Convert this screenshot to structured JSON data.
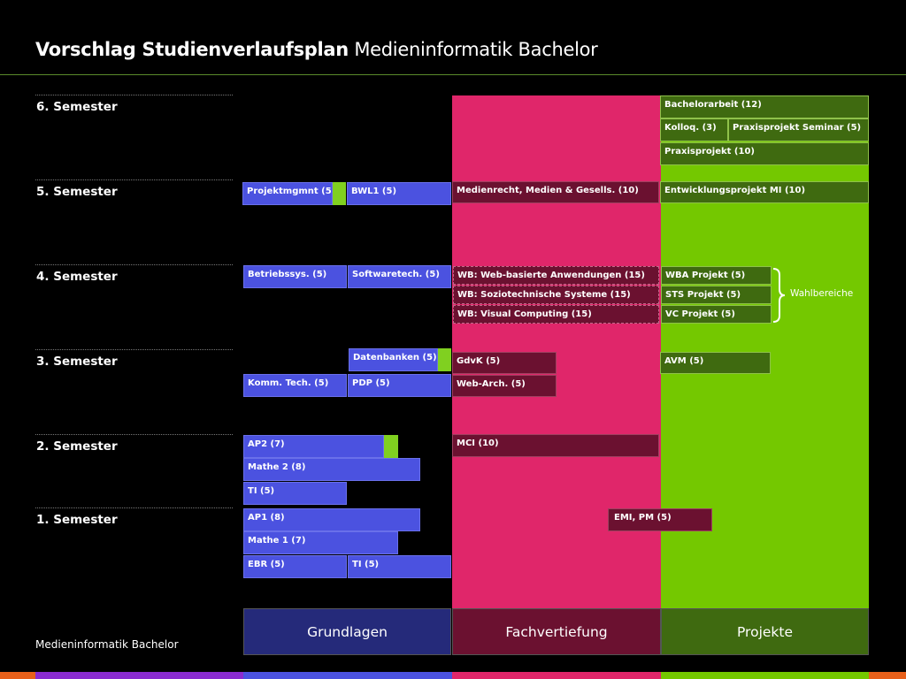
{
  "title": {
    "bold": "Vorschlag Studienverlaufsplan",
    "light": "Medieninformatik Bachelor"
  },
  "semesters": [
    "6. Semester",
    "5. Semester",
    "4. Semester",
    "3. Semester",
    "2. Semester",
    "1. Semester"
  ],
  "columns": {
    "grundlagen": "Grundlagen",
    "fachvertiefung": "Fachvertiefung",
    "projekte": "Projekte"
  },
  "colors": {
    "grundlagen_blue": "#4b52e0",
    "fachvertiefung_pink": "#e0266a",
    "fachvertiefung_maroon": "#6b1130",
    "projekte_green": "#74c800",
    "projekte_dark_green": "#3f6a10",
    "accent_green": "#80d020"
  },
  "modules": {
    "bachelorarbeit": "Bachelorarbeit (12)",
    "kolloq": "Kolloq. (3)",
    "praxisprojekt_seminar": "Praxisprojekt Seminar (5)",
    "praxisprojekt": "Praxisprojekt (10)",
    "projektmgmnt": "Projektmgmnt (5)",
    "bwl1": "BWL1 (5)",
    "medienrecht": "Medienrecht, Medien & Gesells. (10)",
    "entwicklungsprojekt": "Entwicklungsprojekt MI (10)",
    "betriebssys": "Betriebssys. (5)",
    "softwaretech": "Softwaretech. (5)",
    "wb_web": "WB: Web-basierte Anwendungen (15)",
    "wb_sozio": "WB: Soziotechnische Systeme (15)",
    "wb_visual": "WB: Visual Computing (15)",
    "wba_projekt": "WBA Projekt (5)",
    "sts_projekt": "STS Projekt (5)",
    "vc_projekt": "VC Projekt (5)",
    "wahlbereiche": "Wahlbereiche",
    "datenbanken": "Datenbanken (5)",
    "gdvk": "GdvK (5)",
    "avm": "AVM (5)",
    "komm_tech": "Komm. Tech. (5)",
    "pdp": "PDP (5)",
    "web_arch": "Web-Arch. (5)",
    "ap2": "AP2 (7)",
    "mci": "MCI (10)",
    "mathe2": "Mathe 2 (8)",
    "ti": "TI (5)",
    "ap1": "AP1 (8)",
    "emi_pm": "EMI, PM (5)",
    "mathe1": "Mathe 1 (7)",
    "ebr": "EBR (5)",
    "ti_sem1": "TI (5)"
  },
  "footer": "Medieninformatik Bachelor"
}
